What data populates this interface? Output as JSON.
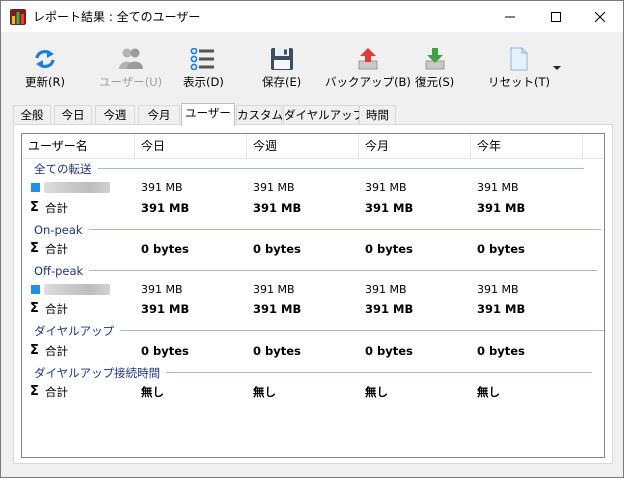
{
  "window": {
    "title": "レポート結果 : 全てのユーザー"
  },
  "toolbar": [
    {
      "label": "更新(R)",
      "icon": "refresh-icon",
      "enabled": true
    },
    {
      "label": "ユーザー(U)",
      "icon": "users-icon",
      "enabled": false
    },
    {
      "label": "表示(D)",
      "icon": "list-view-icon",
      "enabled": true
    },
    {
      "label": "保存(E)",
      "icon": "floppy-disk-icon",
      "enabled": true
    },
    {
      "label": "バックアップ(B)",
      "icon": "upload-arrow-icon",
      "enabled": true
    },
    {
      "label": "復元(S)",
      "icon": "download-arrow-icon",
      "enabled": true
    },
    {
      "label": "リセット(T)",
      "icon": "blank-document-icon",
      "enabled": true
    }
  ],
  "tabs": [
    "全般",
    "今日",
    "今週",
    "今月",
    "ユーザー",
    "カスタム",
    "ダイヤルアップ",
    "時間"
  ],
  "active_tab": "ユーザー",
  "columns": [
    "ユーザー名",
    "今日",
    "今週",
    "今月",
    "今年"
  ],
  "groups": [
    {
      "title": "全ての転送",
      "user": [
        "391 MB",
        "391 MB",
        "391 MB",
        "391 MB"
      ],
      "total_label": "合計",
      "total": [
        "391 MB",
        "391 MB",
        "391 MB",
        "391 MB"
      ]
    },
    {
      "title": "On-peak",
      "total_label": "合計",
      "total": [
        "0 bytes",
        "0 bytes",
        "0 bytes",
        "0 bytes"
      ]
    },
    {
      "title": "Off-peak",
      "user": [
        "391 MB",
        "391 MB",
        "391 MB",
        "391 MB"
      ],
      "total_label": "合計",
      "total": [
        "391 MB",
        "391 MB",
        "391 MB",
        "391 MB"
      ]
    },
    {
      "title": "ダイヤルアップ",
      "total_label": "合計",
      "total": [
        "0 bytes",
        "0 bytes",
        "0 bytes",
        "0 bytes"
      ]
    },
    {
      "title": "ダイヤルアップ接続時間",
      "total_label": "合計",
      "total": [
        "無し",
        "無し",
        "無し",
        "無し"
      ]
    }
  ],
  "colors": {
    "group_text": "#1e3287",
    "user_marker": "#1e90e6"
  }
}
